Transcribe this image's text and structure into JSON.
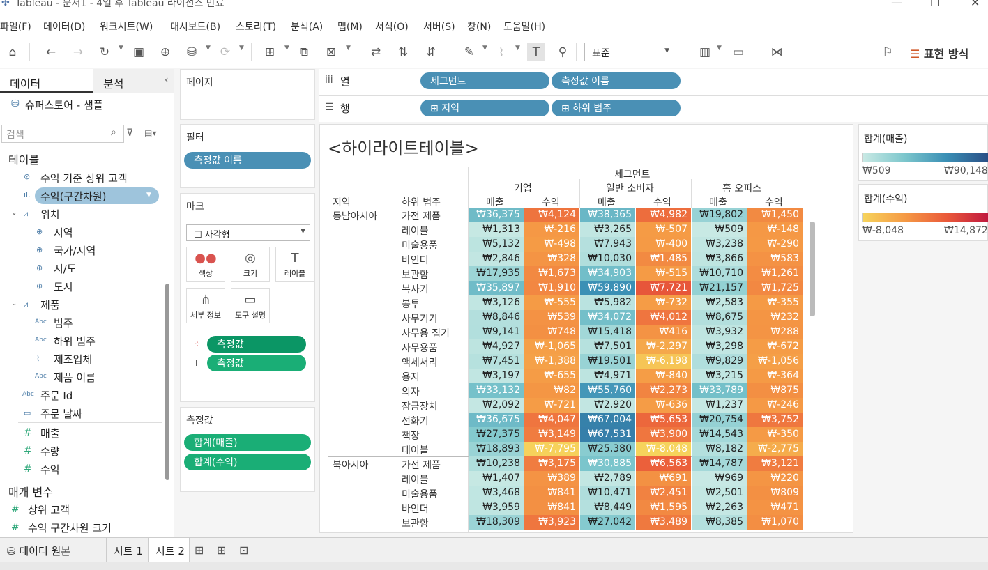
{
  "window": {
    "title": "Tableau - 문서1 - 4일 후 Tableau 라이선스 만료"
  },
  "menu": [
    "파일(F)",
    "데이터(D)",
    "워크시트(W)",
    "대시보드(B)",
    "스토리(T)",
    "분석(A)",
    "맵(M)",
    "서식(O)",
    "서버(S)",
    "창(N)",
    "도움말(H)"
  ],
  "toolbar": {
    "fit_select": "표준",
    "show_me": "표현 방식"
  },
  "left": {
    "tab_data": "데이터",
    "tab_analysis": "분석",
    "datasource": "슈퍼스토어 - 샘플",
    "search_placeholder": "검색",
    "tables_header": "테이블",
    "fields": [
      "수익 기준 상위 고객",
      "수익(구간차원)",
      "위치",
      "지역",
      "국가/지역",
      "시/도",
      "도시",
      "제품",
      "범주",
      "하위 범주",
      "제조업체",
      "제품 이름",
      "주문 Id",
      "주문 날짜",
      "매출",
      "수량",
      "수익"
    ],
    "params_header": "매개 변수",
    "params": [
      "상위 고객",
      "수익 구간차원 크기"
    ]
  },
  "panels": {
    "pages": "페이지",
    "filters": "필터",
    "filter_pill": "측정값 이름",
    "marks": "마크",
    "mark_type": "사각형",
    "mark_buttons": [
      "색상",
      "크기",
      "레이블",
      "세부 정보",
      "도구 설명"
    ],
    "mark_pills": [
      "측정값",
      "측정값"
    ],
    "measures": "측정값",
    "measure_pills": [
      "합계(매출)",
      "합계(수익)"
    ]
  },
  "shelves": {
    "columns_label": "열",
    "rows_label": "행",
    "columns": [
      "세그먼트",
      "측정값 이름"
    ],
    "rows": [
      "지역",
      "하위 범주"
    ]
  },
  "viz": {
    "title": "<하이라이트테이블>",
    "segment_header": "세그먼트",
    "segments": [
      "기업",
      "일반 소비자",
      "홈 오피스"
    ],
    "measure_headers": [
      "매출",
      "수익"
    ],
    "row_headers": [
      "지역",
      "하위 범주"
    ],
    "regions": [
      {
        "name": "동남아시아",
        "rows": [
          [
            "가전 제품",
            "₩36,375",
            "₩4,124",
            "₩38,365",
            "₩4,982",
            "₩19,802",
            "₩1,450"
          ],
          [
            "레이블",
            "₩1,313",
            "₩-216",
            "₩3,265",
            "₩-507",
            "₩509",
            "₩-148"
          ],
          [
            "미술용품",
            "₩5,132",
            "₩-498",
            "₩7,943",
            "₩-400",
            "₩3,238",
            "₩-290"
          ],
          [
            "바인더",
            "₩2,846",
            "₩328",
            "₩10,030",
            "₩1,485",
            "₩3,866",
            "₩583"
          ],
          [
            "보관함",
            "₩17,935",
            "₩1,673",
            "₩34,903",
            "₩-515",
            "₩10,710",
            "₩1,261"
          ],
          [
            "복사기",
            "₩35,897",
            "₩1,910",
            "₩59,890",
            "₩7,721",
            "₩21,157",
            "₩1,725"
          ],
          [
            "봉투",
            "₩3,126",
            "₩-555",
            "₩5,982",
            "₩-732",
            "₩2,583",
            "₩-355"
          ],
          [
            "사무기기",
            "₩8,846",
            "₩539",
            "₩34,072",
            "₩4,012",
            "₩8,675",
            "₩232"
          ],
          [
            "사무용 집기",
            "₩9,141",
            "₩748",
            "₩15,418",
            "₩416",
            "₩3,932",
            "₩288"
          ],
          [
            "사무용품",
            "₩4,927",
            "₩-1,065",
            "₩7,501",
            "₩-2,297",
            "₩3,298",
            "₩-672"
          ],
          [
            "액세서리",
            "₩7,451",
            "₩-1,388",
            "₩19,501",
            "₩-6,198",
            "₩9,829",
            "₩-1,056"
          ],
          [
            "용지",
            "₩3,197",
            "₩-655",
            "₩4,971",
            "₩-840",
            "₩3,215",
            "₩-364"
          ],
          [
            "의자",
            "₩33,132",
            "₩82",
            "₩55,760",
            "₩2,273",
            "₩33,789",
            "₩875"
          ],
          [
            "잠금장치",
            "₩2,092",
            "₩-721",
            "₩2,920",
            "₩-636",
            "₩1,237",
            "₩-246"
          ],
          [
            "전화기",
            "₩36,675",
            "₩4,047",
            "₩67,004",
            "₩5,653",
            "₩20,754",
            "₩3,752"
          ],
          [
            "책장",
            "₩27,375",
            "₩3,149",
            "₩67,531",
            "₩3,900",
            "₩14,543",
            "₩-350"
          ],
          [
            "테이블",
            "₩18,893",
            "₩-7,795",
            "₩25,380",
            "₩-8,048",
            "₩8,182",
            "₩-2,775"
          ]
        ]
      },
      {
        "name": "북아시아",
        "rows": [
          [
            "가전 제품",
            "₩10,238",
            "₩3,175",
            "₩30,885",
            "₩6,563",
            "₩14,787",
            "₩3,121"
          ],
          [
            "레이블",
            "₩1,407",
            "₩389",
            "₩2,789",
            "₩691",
            "₩969",
            "₩220"
          ],
          [
            "미술용품",
            "₩3,468",
            "₩841",
            "₩10,471",
            "₩2,451",
            "₩2,501",
            "₩809"
          ],
          [
            "바인더",
            "₩3,959",
            "₩841",
            "₩8,449",
            "₩1,595",
            "₩2,263",
            "₩471"
          ],
          [
            "보관함",
            "₩18,309",
            "₩3,923",
            "₩27,042",
            "₩3,489",
            "₩8,385",
            "₩1,070"
          ]
        ]
      }
    ]
  },
  "legends": {
    "sales": {
      "title": "합계(매출)",
      "min": "₩509",
      "max": "₩90,148",
      "min_value": 509,
      "max_value": 90148
    },
    "profit": {
      "title": "합계(수익)",
      "min": "₩-8,048",
      "max": "₩14,872",
      "min_value": -8048,
      "max_value": 14872
    }
  },
  "bottom_tabs": [
    "데이터 원본",
    "시트 1",
    "시트 2"
  ]
}
